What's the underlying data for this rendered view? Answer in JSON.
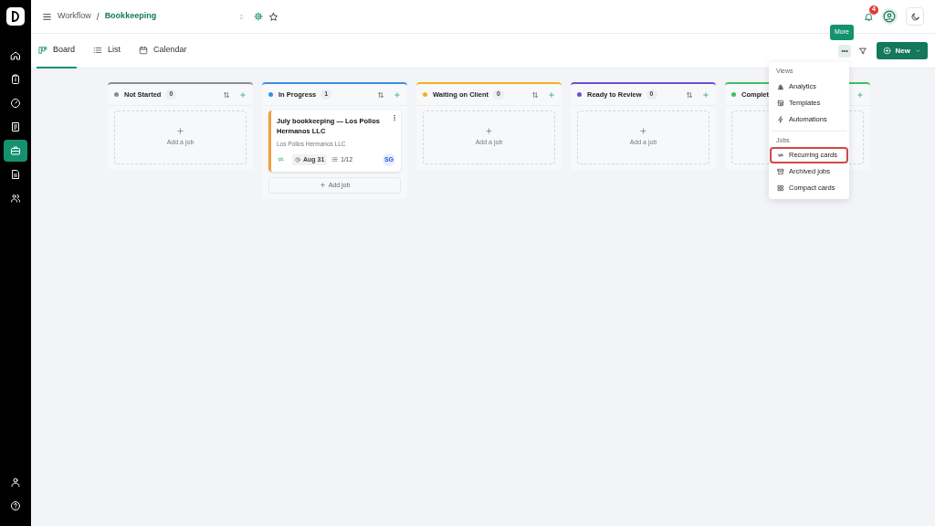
{
  "sidebar": {
    "items": [
      {
        "selected": false
      },
      {
        "selected": false
      },
      {
        "selected": false
      },
      {
        "selected": false
      },
      {
        "selected": true
      },
      {
        "selected": false
      },
      {
        "selected": false
      }
    ]
  },
  "header": {
    "breadcrumb": [
      "Workflow",
      "Bookkeeping"
    ],
    "separator": "/",
    "notification_count": "4"
  },
  "tabs": [
    {
      "label": "Board",
      "selected": true
    },
    {
      "label": "List",
      "selected": false
    },
    {
      "label": "Calendar",
      "selected": false
    }
  ],
  "toolbar": {
    "tooltip": "More",
    "new_button": "New"
  },
  "columns": [
    {
      "name": "Not Started",
      "color": "#8a8d93",
      "count": "0",
      "add_placeholder": "Add a job"
    },
    {
      "name": "In Progress",
      "color": "#3b8fe0",
      "count": "1",
      "cards": [
        {
          "title": "July bookkeeping — Los Pollos Hermanos LLC",
          "client": "Los Pollos Hermanos LLC",
          "due": "Aug 31",
          "checklist": "1/12",
          "assignee": "SG",
          "recurring": true
        }
      ],
      "add_button": "Add job"
    },
    {
      "name": "Waiting on Client",
      "color": "#f2b01e",
      "count": "0",
      "add_placeholder": "Add a job"
    },
    {
      "name": "Ready to Review",
      "color": "#6c4fd8",
      "count": "0",
      "add_placeholder": "Add a job"
    },
    {
      "name": "Complet",
      "color": "#3fbf5f"
    }
  ],
  "menu": {
    "sections": [
      {
        "title": "Views",
        "items": [
          {
            "label": "Analytics",
            "highlighted": false
          },
          {
            "label": "Templates",
            "highlighted": false
          },
          {
            "label": "Automations",
            "highlighted": false
          }
        ]
      },
      {
        "title": "Jobs",
        "items": [
          {
            "label": "Recurring cards",
            "highlighted": true
          },
          {
            "label": "Archived jobs",
            "highlighted": false
          },
          {
            "label": "Compact cards",
            "highlighted": false
          }
        ]
      }
    ]
  }
}
